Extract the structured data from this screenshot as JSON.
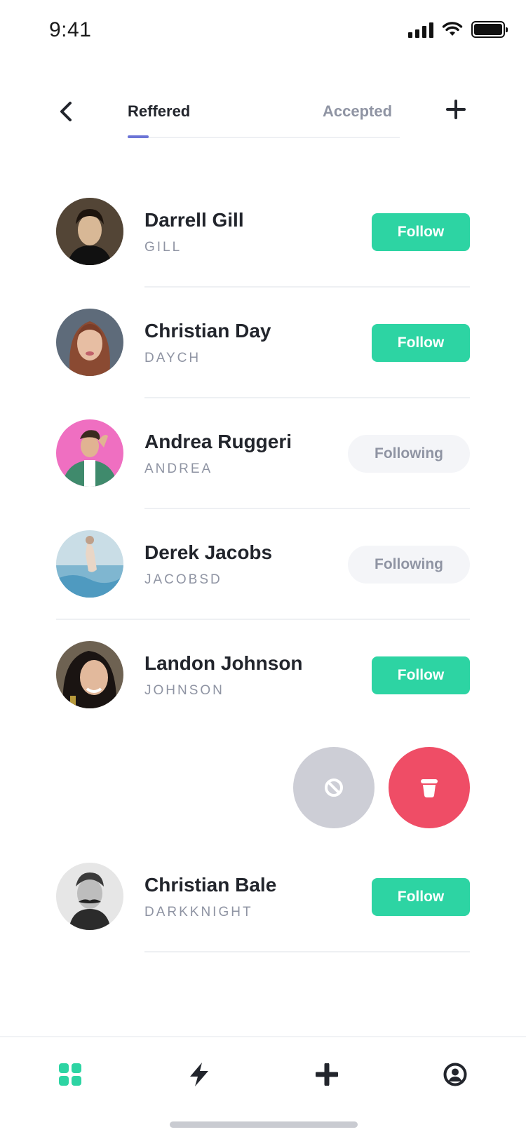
{
  "status_bar": {
    "time": "9:41"
  },
  "header": {
    "tabs": [
      {
        "label": "Reffered",
        "active": true
      },
      {
        "label": "Accepted",
        "active": false
      }
    ]
  },
  "colors": {
    "accent": "#2dd4a3",
    "tab_indicator": "#6b74d6",
    "delete": "#ef4d66",
    "block": "#cdced6"
  },
  "users": [
    {
      "name": "Darrell Gill",
      "handle": "GILL",
      "action": "Follow"
    },
    {
      "name": "Christian Day",
      "handle": "DAYCH",
      "action": "Follow"
    },
    {
      "name": "Andrea Ruggeri",
      "handle": "ANDREA",
      "action": "Following"
    },
    {
      "name": "Derek Jacobs",
      "handle": "JACOBSD",
      "action": "Following"
    },
    {
      "name": "Landon Johnson",
      "handle": "JOHNSON",
      "action": "Follow"
    },
    {
      "name": "Christian Bale",
      "handle": "DARKKNIGHT",
      "action": "Follow"
    }
  ],
  "swipe_actions": [
    {
      "icon": "block-icon"
    },
    {
      "icon": "trash-icon"
    }
  ],
  "bottom_nav": [
    {
      "icon": "grid-icon",
      "active": true
    },
    {
      "icon": "lightning-icon",
      "active": false
    },
    {
      "icon": "plus-icon",
      "active": false
    },
    {
      "icon": "profile-icon",
      "active": false
    }
  ]
}
